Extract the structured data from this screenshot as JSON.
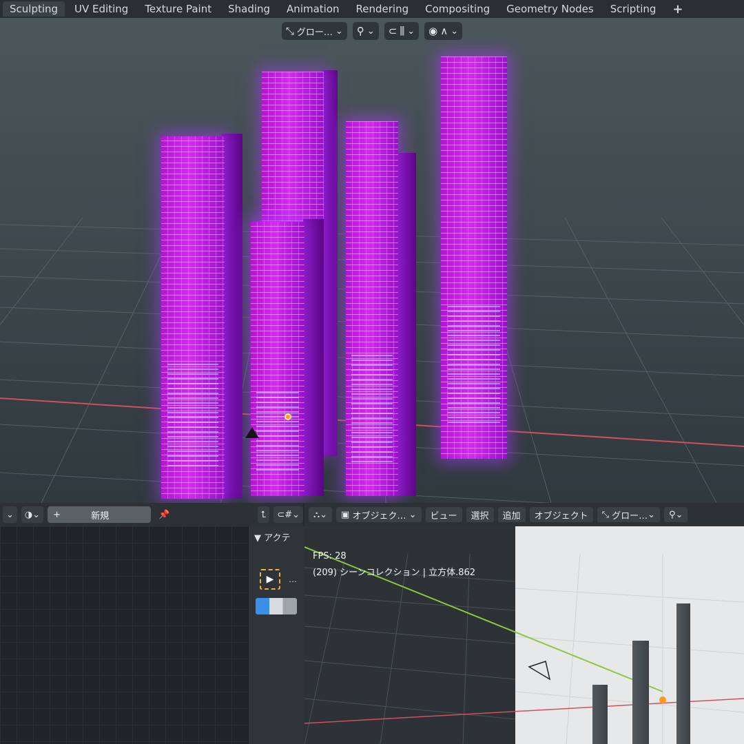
{
  "workspace_tabs": [
    "Sculpting",
    "UV Editing",
    "Texture Paint",
    "Shading",
    "Animation",
    "Rendering",
    "Compositing",
    "Geometry Nodes",
    "Scripting",
    "+"
  ],
  "main_viewport": {
    "transform_orientation": "グロー…"
  },
  "left_editor": {
    "new_button_label": "新規",
    "sidebar_title": "▼ アクテ",
    "tool_dots": "…"
  },
  "small_viewport": {
    "mode_label": "オブジェク…",
    "menu": [
      "ビュー",
      "選択",
      "追加",
      "オブジェクト"
    ],
    "transform_orientation": "グロー…",
    "fps": "FPS: 28",
    "scene_info": "(209) シーンコレクション | 立方体.862"
  },
  "colors": {
    "tower_magenta": "#c81ee8",
    "glow": "#aa3cff",
    "x_axis": "#d2505a",
    "y_axis": "#8cc83c",
    "origin": "#ff9a1a"
  },
  "icons": [
    "transform-orientation-icon",
    "snap-icon",
    "proportional-edit-icon",
    "shading-icon",
    "pin-icon",
    "select-box-icon",
    "link-icon"
  ]
}
